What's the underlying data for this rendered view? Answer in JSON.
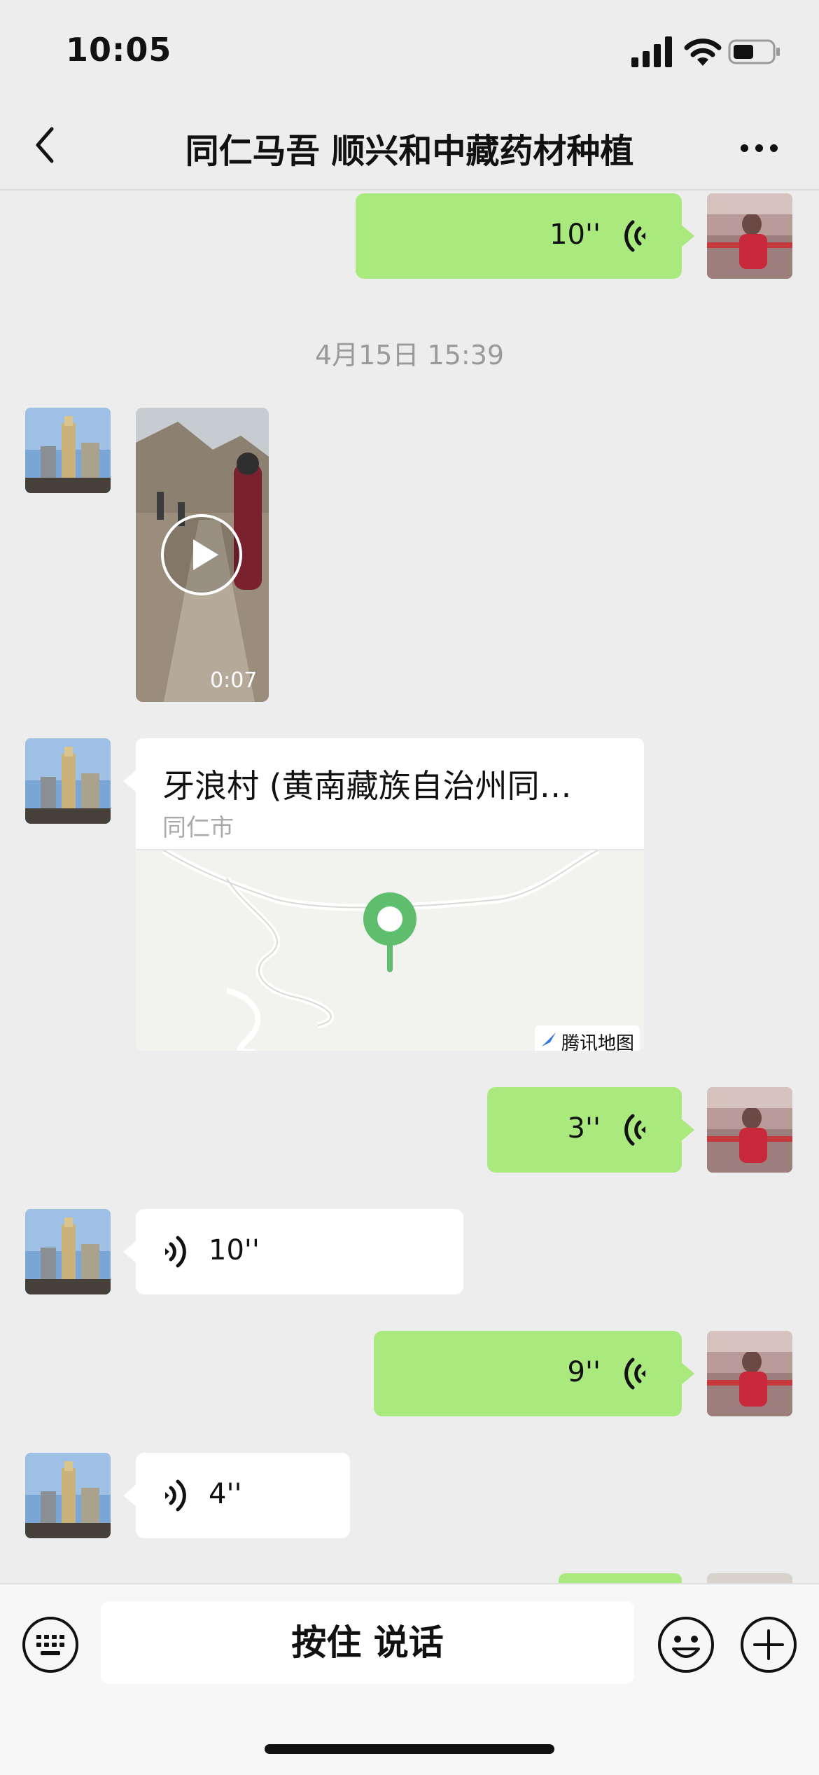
{
  "status_bar": {
    "time": "10:05"
  },
  "header": {
    "title": "同仁马吾 顺兴和中藏药材种植"
  },
  "timestamp": "4月15日 15:39",
  "messages": [
    {
      "sender": "me",
      "type": "voice",
      "duration": "10''"
    },
    {
      "sender": "other",
      "type": "video",
      "duration": "0:07"
    },
    {
      "sender": "other",
      "type": "location",
      "name": "牙浪村 (黄南藏族自治州同…",
      "city": "同仁市",
      "map_brand": "腾讯地图"
    },
    {
      "sender": "me",
      "type": "voice",
      "duration": "3''"
    },
    {
      "sender": "other",
      "type": "voice",
      "duration": "10''"
    },
    {
      "sender": "me",
      "type": "voice",
      "duration": "9''"
    },
    {
      "sender": "other",
      "type": "voice",
      "duration": "4''"
    }
  ],
  "input_bar": {
    "hold_to_talk_label": "按住 说话"
  },
  "colors": {
    "my_bubble": "#a9e97e",
    "other_bubble": "#ffffff",
    "background": "#ededed",
    "map_pin": "#5fbe6e"
  }
}
